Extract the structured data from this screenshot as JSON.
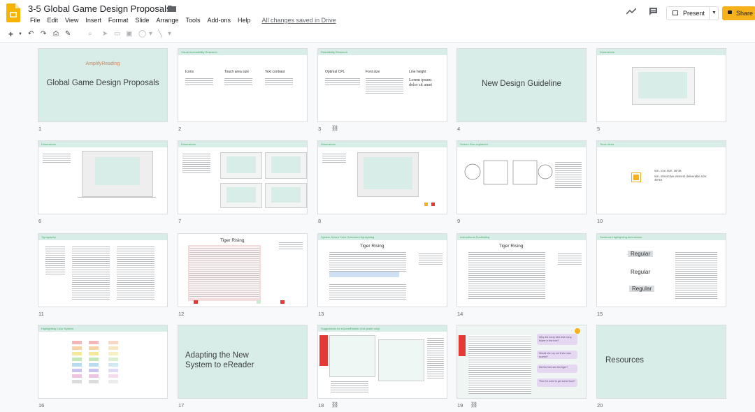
{
  "document": {
    "title": "3-5 Global Game Design Proposals",
    "saved_status": "All changes saved in Drive"
  },
  "menu": [
    "File",
    "Edit",
    "View",
    "Insert",
    "Format",
    "Slide",
    "Arrange",
    "Tools",
    "Add-ons",
    "Help"
  ],
  "header_actions": {
    "present_label": "Present",
    "share_label": "Share"
  },
  "icons": {
    "logo": "google-slides-logo",
    "star": "star-icon",
    "folder": "folder-icon",
    "trend": "activity-trend-icon",
    "comment": "comment-icon",
    "link": "link-icon"
  },
  "colors": {
    "mint": "#d9ede8",
    "accent_yellow": "#f7b21b",
    "slides_brand": "#f4b400"
  },
  "slides": [
    {
      "number": "1",
      "title": "Global Game Design Proposals",
      "brand": "AmplifyReading"
    },
    {
      "number": "2",
      "header": "Visual Accessibility Research",
      "cols": [
        "Icons",
        "Touch area size",
        "Text contrast"
      ]
    },
    {
      "number": "3",
      "header": "Readability Research",
      "cols": [
        "Optimal CPL",
        "Font size",
        "Line height"
      ],
      "sample": "Lorem ipsum dolor sit amet"
    },
    {
      "number": "4",
      "title": "New Design Guideline"
    },
    {
      "number": "5",
      "header": "Dimensions"
    },
    {
      "number": "6",
      "header": "Dimensions"
    },
    {
      "number": "7",
      "header": "Dimensions"
    },
    {
      "number": "8",
      "header": "Dimensions"
    },
    {
      "number": "9",
      "header": "Screen Size explained"
    },
    {
      "number": "10",
      "header": "Touch Area",
      "lines": [
        "min. icon size: 36*36",
        "min. interactive element deliverable size: 48*48"
      ]
    },
    {
      "number": "11",
      "header": "Typography"
    },
    {
      "number": "12",
      "story": "Tiger Rising"
    },
    {
      "number": "13",
      "header": "System Driven Color Selection Highlighting",
      "story": "Tiger Rising"
    },
    {
      "number": "14",
      "header": "Instructional Scaffolding",
      "story": "Tiger Rising"
    },
    {
      "number": "15",
      "header": "Sentence Highlighting dimensions",
      "labels": [
        "Regular",
        "Regular",
        "Regular"
      ]
    },
    {
      "number": "16",
      "header": "Highlighting Color System"
    },
    {
      "number": "17",
      "title": "Adapting the New System to eReader"
    },
    {
      "number": "18",
      "header": "Suggestions for eQuestReader (3rd grade only)"
    },
    {
      "number": "19",
      "bubbles": [
        "Why did every bird visit every flower in the tree?",
        "Would she cry out if she was scared?",
        "Did the bird see the tiger?",
        "Then he went to get some food?"
      ]
    },
    {
      "number": "20",
      "title": "Resources"
    }
  ]
}
